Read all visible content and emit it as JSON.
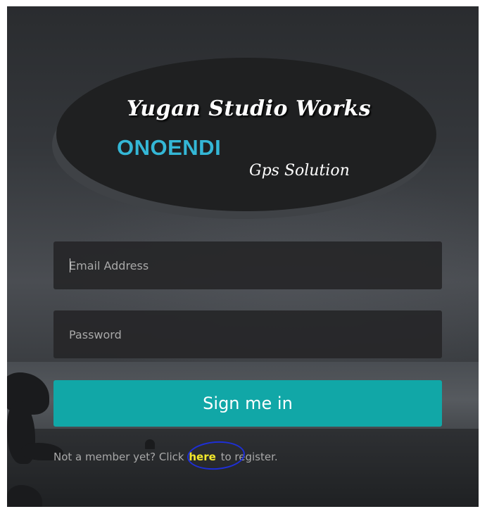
{
  "logo": {
    "title": "Yugan Studio Works",
    "brand": "ONOENDI",
    "tagline": "Gps Solution"
  },
  "form": {
    "email_placeholder": "Email Address",
    "password_placeholder": "Password",
    "signin_label": "Sign me in"
  },
  "register": {
    "prefix": "Not a member yet? Click ",
    "link": "here",
    "suffix": " to register."
  },
  "colors": {
    "brand": "#34b7d6",
    "button": "#11a7a7",
    "link": "#f2e82c",
    "annotation": "#1e2fd6"
  }
}
